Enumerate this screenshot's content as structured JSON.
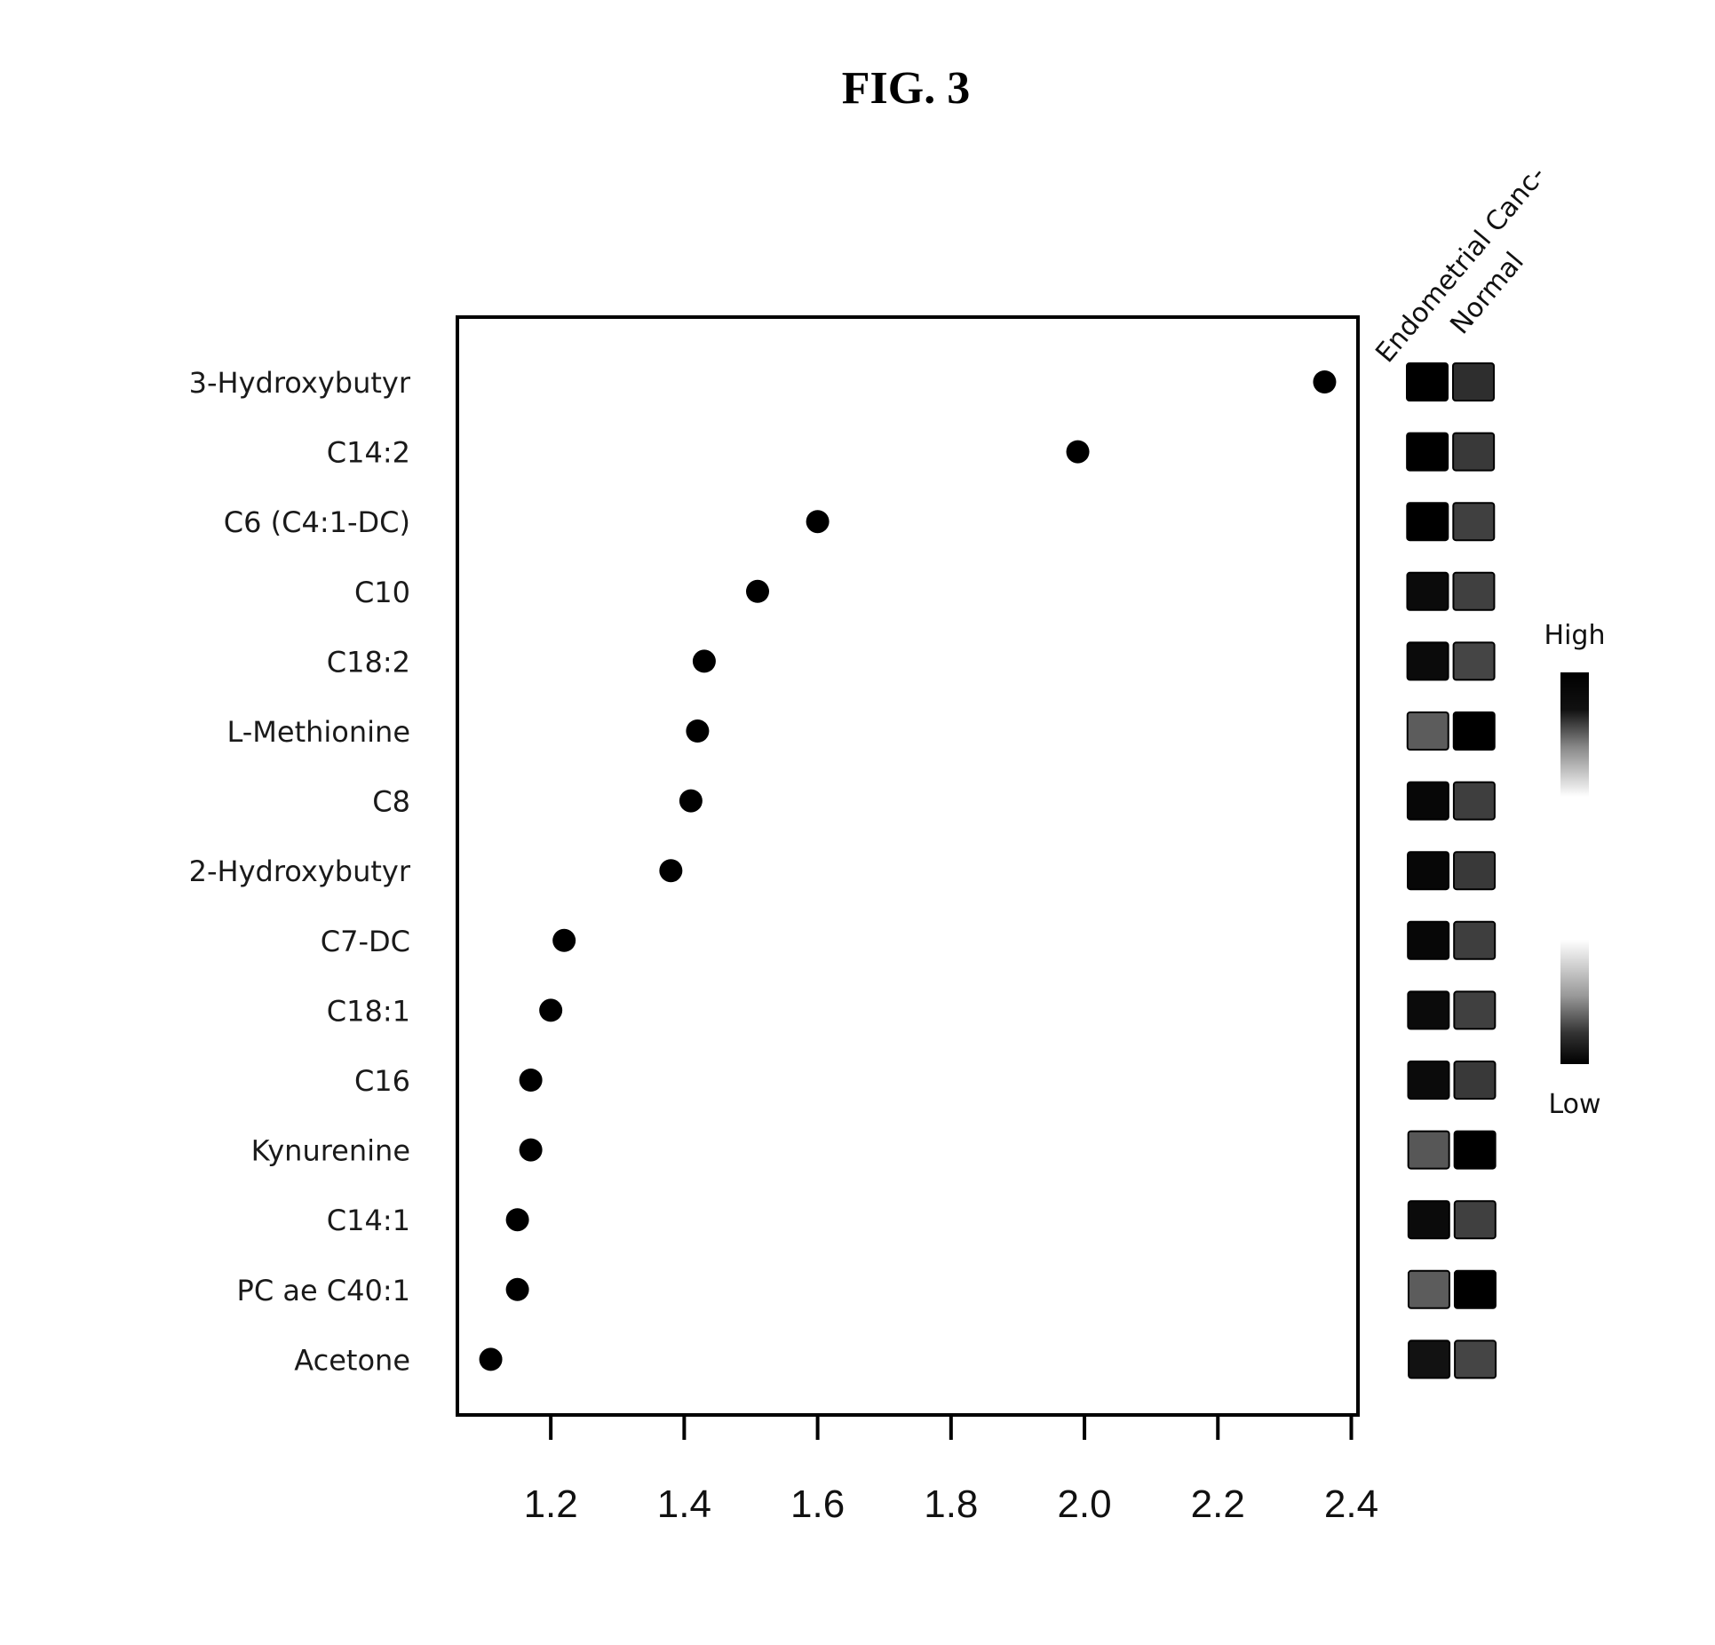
{
  "figure": {
    "title": "FIG. 3"
  },
  "chart_data": {
    "type": "scatter",
    "subtype": "dot-plot-with-heatmap",
    "title": "FIG. 3",
    "xlabel": "",
    "ylabel": "",
    "xlim": [
      1.06,
      2.41
    ],
    "xticks": [
      1.2,
      1.4,
      1.6,
      1.8,
      2.0,
      2.2,
      2.4
    ],
    "xtick_labels": [
      "1.2",
      "1.4",
      "1.6",
      "1.8",
      "2.0",
      "2.2",
      "2.4"
    ],
    "grid": false,
    "categories": [
      "3-Hydroxybutyr",
      "C14:2",
      "C6 (C4:1-DC)",
      "C10",
      "C18:2",
      "L-Methionine",
      "C8",
      "2-Hydroxybutyr",
      "C7-DC",
      "C18:1",
      "C16",
      "Kynurenine",
      "C14:1",
      "PC ae C40:1",
      "Acetone"
    ],
    "values": [
      2.36,
      1.99,
      1.6,
      1.51,
      1.43,
      1.42,
      1.41,
      1.38,
      1.22,
      1.2,
      1.17,
      1.17,
      1.15,
      1.15,
      1.11
    ],
    "heatmap": {
      "columns": [
        "Endometrial Canc-",
        "Normal"
      ],
      "levels_note": "relative level 0 (Low) to 1 (High)",
      "rows": [
        [
          1.0,
          0.8
        ],
        [
          1.0,
          0.75
        ],
        [
          1.0,
          0.72
        ],
        [
          0.95,
          0.72
        ],
        [
          0.95,
          0.7
        ],
        [
          0.6,
          1.0
        ],
        [
          0.97,
          0.73
        ],
        [
          0.97,
          0.75
        ],
        [
          0.97,
          0.73
        ],
        [
          0.95,
          0.72
        ],
        [
          0.95,
          0.75
        ],
        [
          0.62,
          1.0
        ],
        [
          0.95,
          0.72
        ],
        [
          0.6,
          1.0
        ],
        [
          0.92,
          0.7
        ]
      ]
    },
    "legend": {
      "position": "right",
      "high_label": "High",
      "low_label": "Low",
      "colors": {
        "high": "#000000",
        "low": "#ffffff"
      }
    },
    "marker_color": "#000000"
  }
}
